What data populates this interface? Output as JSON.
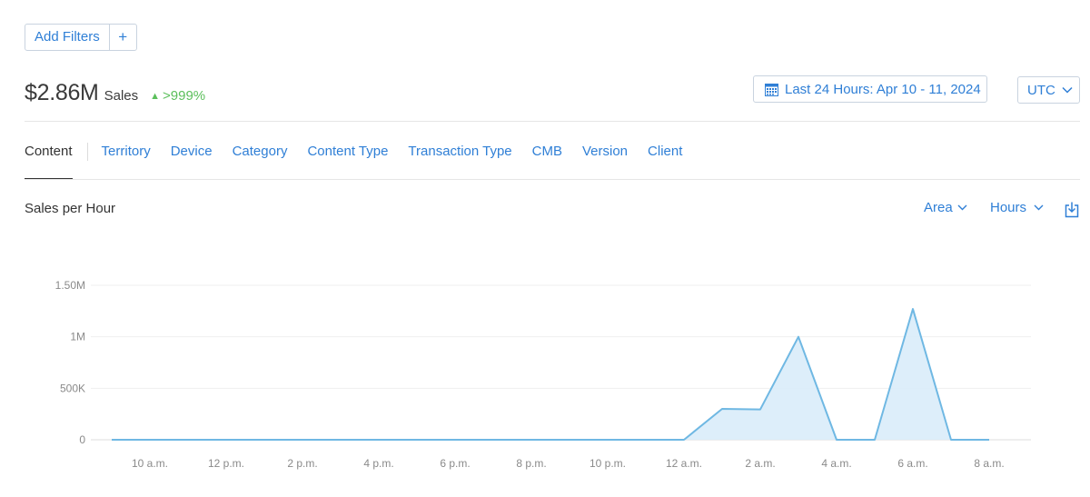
{
  "filters": {
    "label": "Add Filters",
    "plus": "+"
  },
  "summary": {
    "amount": "$2.86M",
    "label": "Sales",
    "change": ">999%",
    "change_color": "#5bbf5b"
  },
  "date_range": {
    "label": "Last 24 Hours: Apr 10 - 11, 2024",
    "icon": "calendar-icon"
  },
  "timezone": {
    "label": "UTC"
  },
  "tabs": [
    {
      "label": "Content",
      "active": true
    },
    {
      "label": "Territory"
    },
    {
      "label": "Device"
    },
    {
      "label": "Category"
    },
    {
      "label": "Content Type"
    },
    {
      "label": "Transaction Type"
    },
    {
      "label": "CMB"
    },
    {
      "label": "Version"
    },
    {
      "label": "Client"
    }
  ],
  "chart_header": {
    "title": "Sales per Hour",
    "type_control": "Area",
    "interval_control": "Hours",
    "download_icon": "download-icon"
  },
  "colors": {
    "accent": "#2f7fd6",
    "series_line": "#6fb8e3",
    "series_fill": "#d9ecfa"
  },
  "chart_data": {
    "type": "area",
    "title": "Sales per Hour",
    "x": [
      "9 a.m.",
      "10 a.m.",
      "11 a.m.",
      "12 p.m.",
      "1 p.m.",
      "2 p.m.",
      "3 p.m.",
      "4 p.m.",
      "5 p.m.",
      "6 p.m.",
      "7 p.m.",
      "8 p.m.",
      "9 p.m.",
      "10 p.m.",
      "11 p.m.",
      "12 a.m.",
      "1 a.m.",
      "2 a.m.",
      "3 a.m.",
      "4 a.m.",
      "5 a.m.",
      "6 a.m.",
      "7 a.m.",
      "8 a.m."
    ],
    "values": [
      0,
      0,
      0,
      0,
      0,
      0,
      0,
      0,
      0,
      0,
      0,
      0,
      0,
      0,
      0,
      0,
      300000,
      295000,
      1000000,
      0,
      0,
      1270000,
      0,
      0
    ],
    "x_tick_labels": [
      "10 a.m.",
      "12 p.m.",
      "2 p.m.",
      "4 p.m.",
      "6 p.m.",
      "8 p.m.",
      "10 p.m.",
      "12 a.m.",
      "2 a.m.",
      "4 a.m.",
      "6 a.m.",
      "8 a.m."
    ],
    "y_ticks": [
      0,
      500000,
      1000000,
      1500000
    ],
    "y_tick_labels": [
      "0",
      "500K",
      "1M",
      "1.50M"
    ],
    "ylim": [
      0,
      1500000
    ],
    "grid": true,
    "legend": "none"
  }
}
